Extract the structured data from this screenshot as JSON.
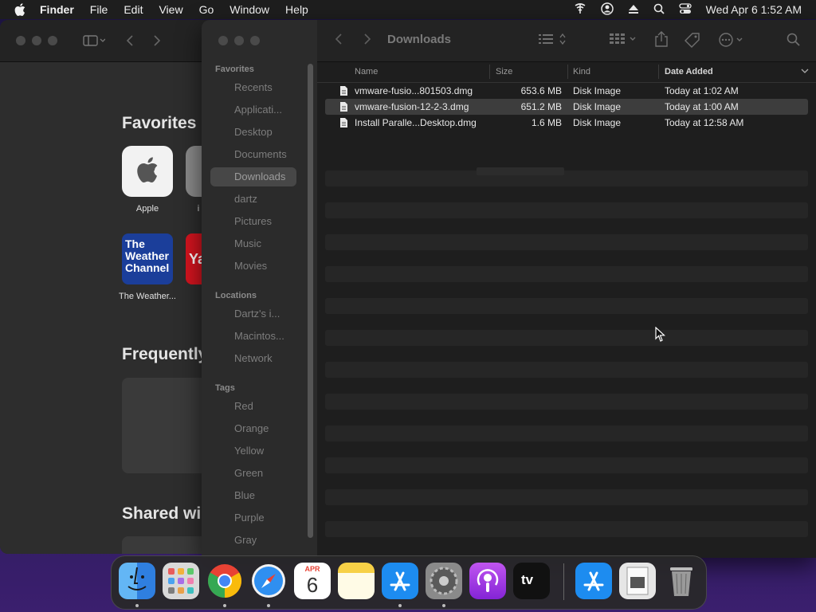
{
  "menubar": {
    "app_name": "Finder",
    "items": [
      "File",
      "Edit",
      "View",
      "Go",
      "Window",
      "Help"
    ],
    "clock": "Wed Apr 6  1:52 AM"
  },
  "background_window": {
    "favorites_title": "Favorites",
    "frequently_title": "Frequently",
    "shared_title": "Shared wi",
    "tiles": [
      {
        "label": "Apple"
      },
      {
        "label": "i"
      },
      {
        "label": "The Weather..."
      },
      {
        "label": "Ya"
      }
    ],
    "weather_logo_text": "The Weather Channel"
  },
  "finder": {
    "title": "Downloads",
    "sidebar": {
      "favorites_label": "Favorites",
      "favorites": [
        "Recents",
        "Applicati...",
        "Desktop",
        "Documents",
        "Downloads",
        "dartz",
        "Pictures",
        "Music",
        "Movies"
      ],
      "locations_label": "Locations",
      "locations": [
        "Dartz's i...",
        "Macintos...",
        "Network"
      ],
      "tags_label": "Tags",
      "tags": [
        "Red",
        "Orange",
        "Yellow",
        "Green",
        "Blue",
        "Purple",
        "Gray"
      ]
    },
    "columns": {
      "name": "Name",
      "size": "Size",
      "kind": "Kind",
      "date": "Date Added"
    },
    "files": [
      {
        "name": "vmware-fusio...801503.dmg",
        "size": "653.6 MB",
        "kind": "Disk Image",
        "date": "Today at 1:02 AM"
      },
      {
        "name": "vmware-fusion-12-2-3.dmg",
        "size": "651.2 MB",
        "kind": "Disk Image",
        "date": "Today at 1:00 AM"
      },
      {
        "name": "Install Paralle...Desktop.dmg",
        "size": "1.6 MB",
        "kind": "Disk Image",
        "date": "Today at 12:58 AM"
      }
    ]
  },
  "dock": {
    "calendar_month": "APR",
    "calendar_day": "6",
    "tv_label": "tv"
  },
  "colors": {
    "menubar_bg": "#1e1e1e",
    "finder_bg": "#1e1e1e",
    "sidebar_bg": "#2b2b2b",
    "selected_row": "#3d3d3d"
  }
}
